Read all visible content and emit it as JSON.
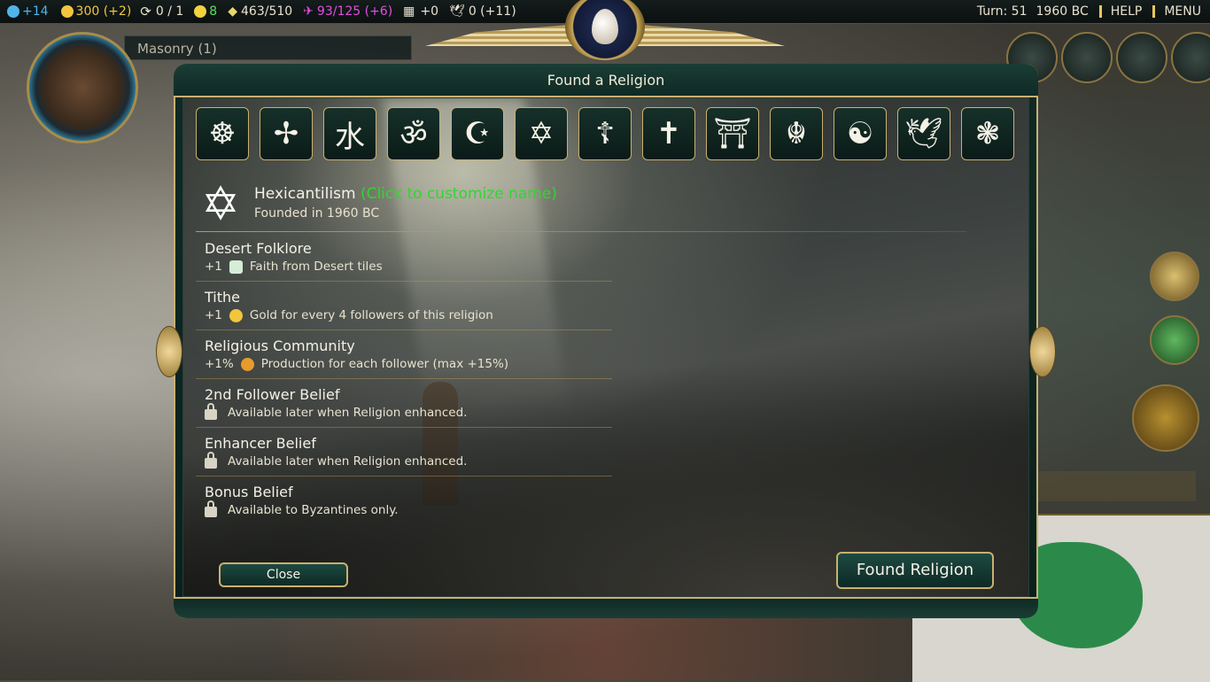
{
  "topbar": {
    "science": "+14",
    "gold": "300 (+2)",
    "trade": "0 / 1",
    "happiness": "8",
    "culture": "463/510",
    "tourism": "93/125 (+6)",
    "great_works": "+0",
    "faith": "0 (+11)",
    "turn": "Turn: 51",
    "year": "1960 BC",
    "help_label": "HELP",
    "menu_label": "MENU"
  },
  "left_panel": {
    "research_label": "Masonry (1)"
  },
  "dialog": {
    "title": "Found a Religion",
    "religion_icons": [
      "☸",
      "✢",
      "水",
      "ॐ",
      "☪",
      "✡",
      "☦",
      "✝",
      "⛩",
      "☬",
      "☯",
      "🕊",
      "❃"
    ],
    "religion_symbol": "✡",
    "religion_name": "Hexicantilism",
    "customize_hint": "(Click to customize name)",
    "founded": "Founded in 1960 BC",
    "beliefs": [
      {
        "name": "Desert Folklore",
        "prefix": "+1",
        "icon": "faith-icon",
        "text": "Faith from Desert tiles"
      },
      {
        "name": "Tithe",
        "prefix": "+1",
        "icon": "gold-icon",
        "text": "Gold for every 4 followers of this religion"
      },
      {
        "name": "Religious Community",
        "prefix": "+1%",
        "icon": "production-icon",
        "text": "Production for each follower (max +15%)"
      },
      {
        "name": "2nd Follower Belief",
        "icon": "lock-icon",
        "text": "Available later when Religion enhanced."
      },
      {
        "name": "Enhancer Belief",
        "icon": "lock-icon",
        "text": "Available later when Religion enhanced."
      },
      {
        "name": "Bonus Belief",
        "icon": "lock-icon",
        "text": "Available to Byzantines only."
      }
    ],
    "close_label": "Close",
    "found_label": "Found Religion"
  },
  "colors": {
    "accent_gold": "#c9b071",
    "customize_green": "#2fd72f",
    "science_blue": "#4fb5e8",
    "gold_yellow": "#f2c53d",
    "tourism_magenta": "#e04fe0",
    "happy_green": "#5ce05c"
  }
}
